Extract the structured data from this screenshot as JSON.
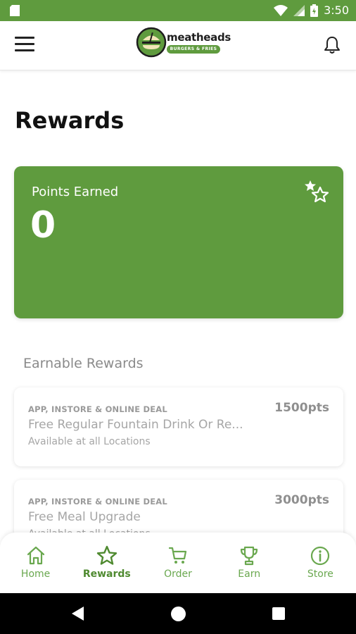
{
  "status_bar": {
    "time": "3:50"
  },
  "header": {
    "logo_name": "meatheads",
    "logo_tagline": "BURGERS & FRIES"
  },
  "page": {
    "title": "Rewards"
  },
  "points_card": {
    "label": "Points Earned",
    "value": "0",
    "background": "#5f9b3e"
  },
  "earnable": {
    "heading": "Earnable Rewards",
    "items": [
      {
        "type": "APP, INSTORE & ONLINE DEAL",
        "points": "1500pts",
        "name": "Free Regular Fountain Drink Or Re...",
        "location": "Available at all Locations"
      },
      {
        "type": "APP, INSTORE & ONLINE DEAL",
        "points": "3000pts",
        "name": "Free Meal Upgrade",
        "location": "Available at all Locations"
      }
    ]
  },
  "bottom_nav": {
    "items": [
      {
        "label": "Home",
        "icon": "home-icon"
      },
      {
        "label": "Rewards",
        "icon": "star-icon",
        "active": true
      },
      {
        "label": "Order",
        "icon": "cart-icon"
      },
      {
        "label": "Earn",
        "icon": "trophy-icon"
      },
      {
        "label": "Store",
        "icon": "info-icon"
      }
    ]
  },
  "colors": {
    "brand_green": "#5f9b3e",
    "nav_green": "#6aa84f"
  }
}
